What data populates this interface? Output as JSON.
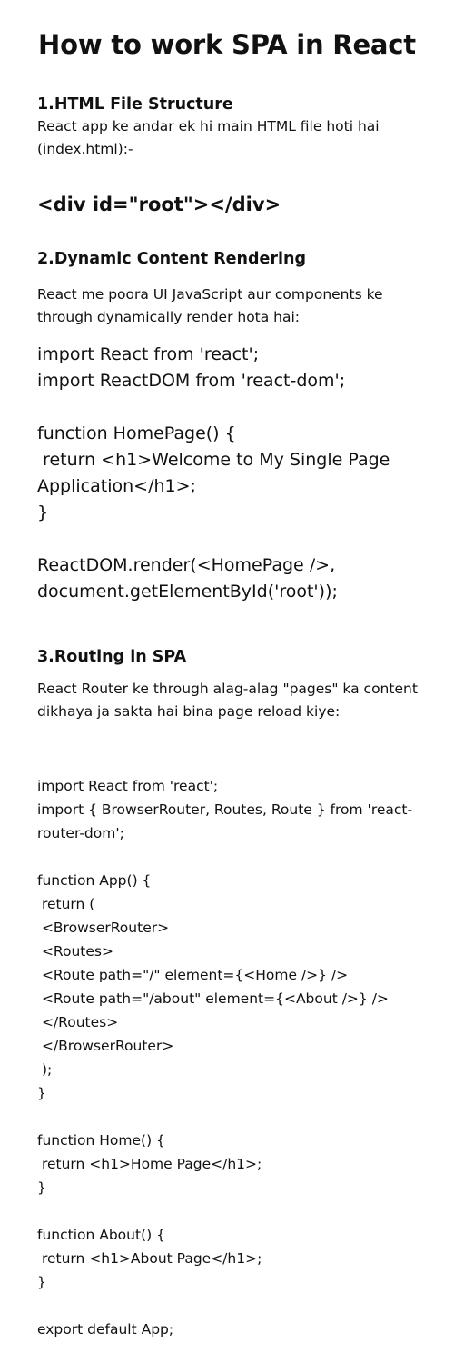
{
  "title": "How to work SPA in React",
  "sections": [
    {
      "heading": "1.HTML File Structure",
      "description": "React app ke andar ek hi main HTML file hoti hai (index.html):-",
      "code": "<div id=\"root\"></div>"
    },
    {
      "heading": "2.Dynamic Content Rendering",
      "description": "React me poora UI JavaScript aur components ke through dynamically render hota hai:",
      "code": "import React from 'react';\nimport ReactDOM from 'react-dom';\n\nfunction HomePage() {\n return <h1>Welcome to My Single Page Application</h1>;\n}\n\nReactDOM.render(<HomePage />, document.getElementById('root'));"
    },
    {
      "heading": "3.Routing in SPA",
      "description": "React Router ke through alag-alag \"pages\" ka content dikhaya ja sakta hai bina page reload kiye:",
      "code": "import React from 'react';\nimport { BrowserRouter, Routes, Route } from 'react-router-dom';\n\nfunction App() {\n return (\n <BrowserRouter>\n <Routes>\n <Route path=\"/\" element={<Home />} />\n <Route path=\"/about\" element={<About />} />\n </Routes>\n </BrowserRouter>\n );\n}\n\nfunction Home() {\n return <h1>Home Page</h1>;\n}\n\nfunction About() {\n return <h1>About Page</h1>;\n}\n\nexport default App;"
    }
  ]
}
